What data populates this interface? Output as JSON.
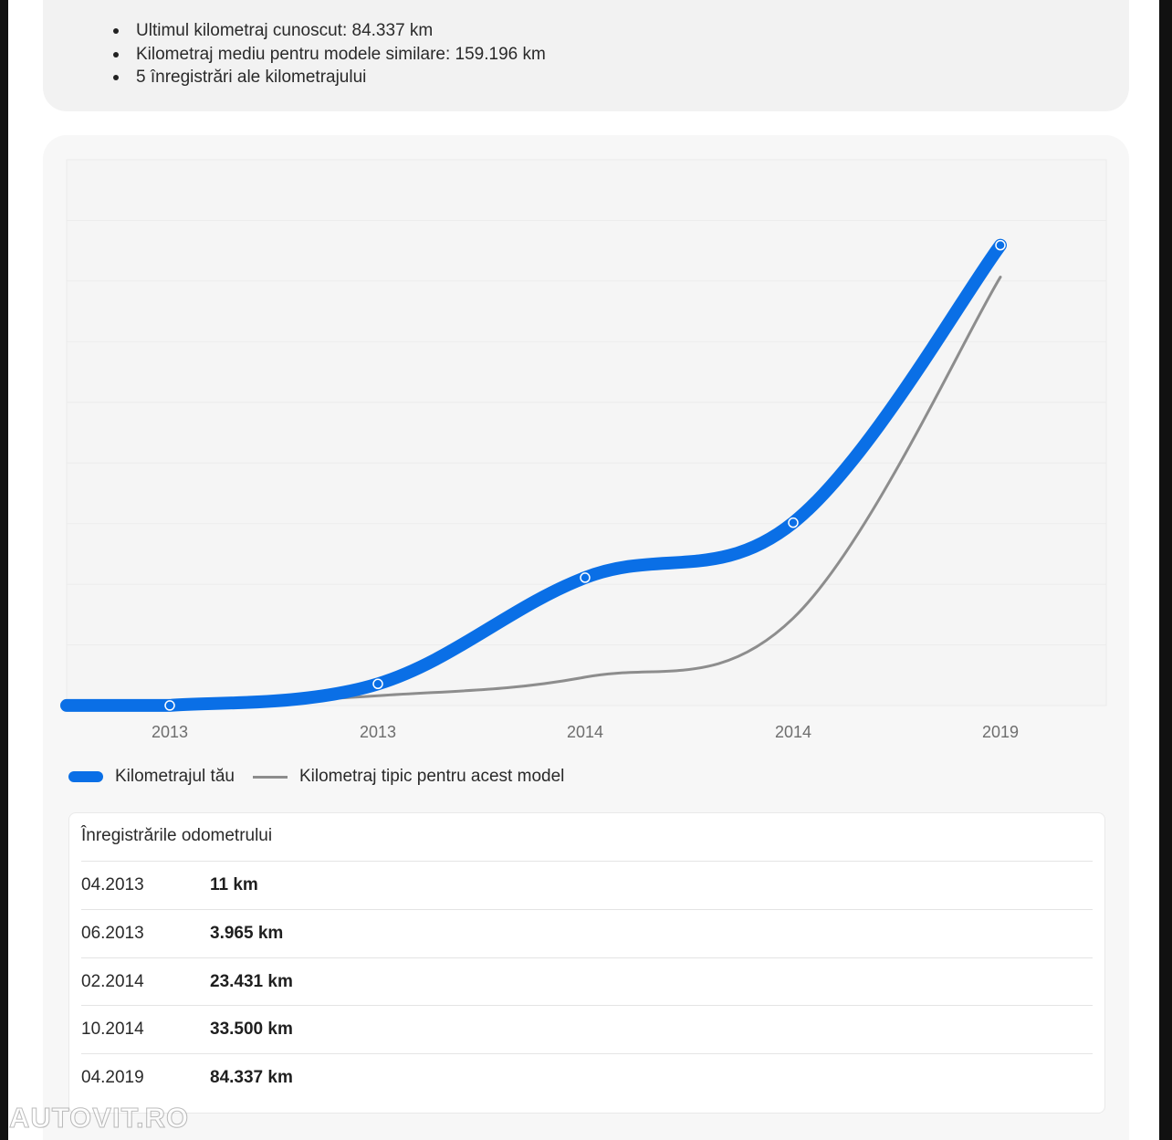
{
  "summary": {
    "items": [
      "Ultimul kilometraj cunoscut: 84.337 km",
      "Kilometraj mediu pentru modele similare: 159.196 km",
      "5 înregistrări ale kilometrajului"
    ]
  },
  "chart_data": {
    "type": "line",
    "categories": [
      "2013",
      "2013",
      "2014",
      "2014",
      "2019"
    ],
    "series": [
      {
        "name": "Kilometrajul tău",
        "values": [
          11,
          3965,
          23431,
          33500,
          84337
        ],
        "color": "#0a6fe6"
      },
      {
        "name": "Kilometraj tipic pentru acest model",
        "values": [
          11,
          1800,
          5200,
          16000,
          78500
        ],
        "color": "#8d8d8d"
      }
    ],
    "ylim": [
      0,
      100000
    ],
    "grid": true,
    "legend_position": "bottom-left"
  },
  "legend": {
    "yours": "Kilometrajul tău",
    "typical": "Kilometraj tipic pentru acest model"
  },
  "records": {
    "title": "Înregistrările odometrului",
    "rows": [
      {
        "date": "04.2013",
        "value": "11 km"
      },
      {
        "date": "06.2013",
        "value": "3.965 km"
      },
      {
        "date": "02.2014",
        "value": "23.431 km"
      },
      {
        "date": "10.2014",
        "value": "33.500 km"
      },
      {
        "date": "04.2019",
        "value": "84.337 km"
      }
    ]
  },
  "watermark": "AUTOVIT.RO"
}
